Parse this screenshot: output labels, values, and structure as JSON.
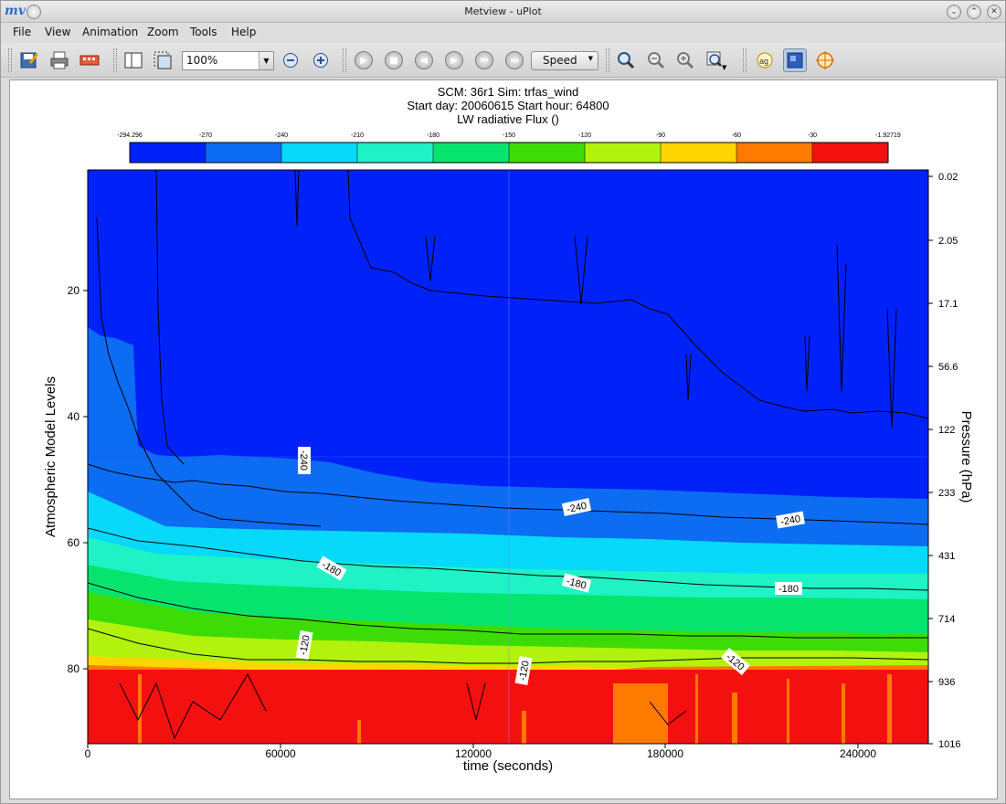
{
  "window": {
    "title": "Metview - uPlot",
    "logo": "mv-logo-icon",
    "controls": [
      "minimize-icon",
      "maximize-icon",
      "close-icon"
    ]
  },
  "menu": {
    "items": [
      {
        "label": "File",
        "mnemonic": "F"
      },
      {
        "label": "View",
        "mnemonic": "V"
      },
      {
        "label": "Animation",
        "mnemonic": "A"
      },
      {
        "label": "Zoom",
        "mnemonic": "Z"
      },
      {
        "label": "Tools",
        "mnemonic": "T"
      },
      {
        "label": "Help",
        "mnemonic": "H"
      }
    ]
  },
  "toolbar": {
    "zoom_value": "100%",
    "speed_label": "Speed",
    "icons": [
      "export-icon",
      "print-icon",
      "cmap-icon",
      "sidebar-icon",
      "zoom-area-icon",
      "zoom-out-icon",
      "zoom-in-icon",
      "play-icon",
      "stop-icon",
      "prev-icon",
      "next-icon",
      "first-icon",
      "last-icon",
      "magnifier-icon",
      "zoom-out-lens-icon",
      "zoom-in-lens-icon",
      "zoom-history-icon",
      "magics-icon",
      "layers-icon",
      "cursor-data-icon"
    ]
  },
  "plot": {
    "title_lines": [
      "SCM: 36r1  Sim: trfas_wind",
      "Start day: 20060615 Start hour: 64800",
      "LW radiative Flux ()"
    ],
    "legend_labels": [
      "-294.296",
      "-270",
      "-240",
      "-210",
      "-180",
      "-150",
      "-120",
      "-90",
      "-60",
      "-30",
      "-1.92719"
    ],
    "legend_colors": [
      "#0022f8",
      "#0c6cf2",
      "#07d9fb",
      "#1ff2c4",
      "#07e46d",
      "#3ddc07",
      "#b2f20d",
      "#ffd500",
      "#ff7a00",
      "#f51010"
    ],
    "x_label": "time (seconds)",
    "y_label_left": "Atmospheric Model Levels",
    "y_label_right": "Pressure (hPa)",
    "x_ticks": [
      "0",
      "60000",
      "120000",
      "180000",
      "240000"
    ],
    "y_ticks_left": [
      "20",
      "40",
      "60",
      "80"
    ],
    "y_ticks_right": [
      "0.02",
      "2.05",
      "17.1",
      "56.6",
      "122",
      "233",
      "431",
      "714",
      "936",
      "1016"
    ],
    "contour_labels": [
      "-240",
      "-240",
      "-240",
      "-180",
      "-180",
      "-180",
      "-120",
      "-120",
      "-120"
    ]
  }
}
